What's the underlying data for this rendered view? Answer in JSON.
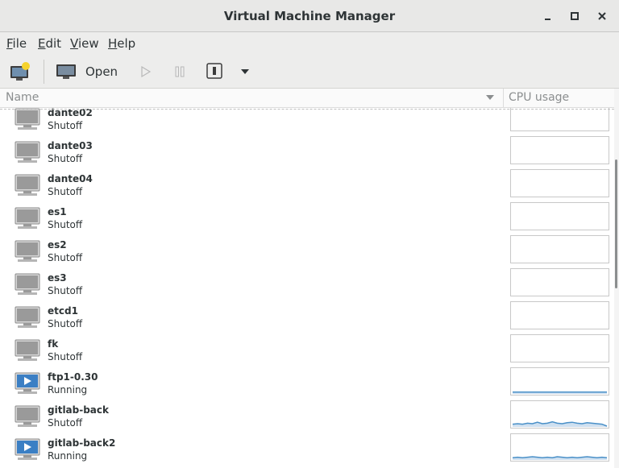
{
  "window": {
    "title": "Virtual Machine Manager"
  },
  "menubar": [
    {
      "label": "File",
      "u": "F",
      "rest": "ile"
    },
    {
      "label": "Edit",
      "u": "E",
      "rest": "dit"
    },
    {
      "label": "View",
      "u": "V",
      "rest": "iew"
    },
    {
      "label": "Help",
      "u": "H",
      "rest": "elp"
    }
  ],
  "toolbar": {
    "open_label": "Open"
  },
  "columns": {
    "name": "Name",
    "cpu": "CPU usage"
  },
  "colors": {
    "vm_off": "#9a9a9a",
    "vm_running": "#3b7fc4",
    "graph_line": "#4a90c8"
  },
  "vms": [
    {
      "name": "dante02",
      "status": "Shutoff",
      "running": false,
      "cpu": []
    },
    {
      "name": "dante03",
      "status": "Shutoff",
      "running": false,
      "cpu": []
    },
    {
      "name": "dante04",
      "status": "Shutoff",
      "running": false,
      "cpu": []
    },
    {
      "name": "es1",
      "status": "Shutoff",
      "running": false,
      "cpu": []
    },
    {
      "name": "es2",
      "status": "Shutoff",
      "running": false,
      "cpu": []
    },
    {
      "name": "es3",
      "status": "Shutoff",
      "running": false,
      "cpu": []
    },
    {
      "name": "etcd1",
      "status": "Shutoff",
      "running": false,
      "cpu": []
    },
    {
      "name": "fk",
      "status": "Shutoff",
      "running": false,
      "cpu": []
    },
    {
      "name": "ftp1-0.30",
      "status": "Running",
      "running": true,
      "cpu": [
        2,
        2,
        2,
        2,
        2,
        2,
        2,
        2,
        2,
        2,
        2,
        2,
        2,
        2,
        2,
        2,
        2,
        2,
        2,
        2
      ]
    },
    {
      "name": "gitlab-back",
      "status": "Shutoff",
      "running": false,
      "cpu": [
        4,
        5,
        4,
        6,
        5,
        8,
        5,
        6,
        9,
        6,
        5,
        7,
        8,
        6,
        5,
        7,
        6,
        5,
        4,
        0
      ]
    },
    {
      "name": "gitlab-back2",
      "status": "Running",
      "running": true,
      "cpu": [
        3,
        4,
        3,
        4,
        5,
        4,
        3,
        4,
        3,
        5,
        4,
        3,
        4,
        3,
        4,
        5,
        4,
        3,
        4,
        3
      ]
    }
  ]
}
